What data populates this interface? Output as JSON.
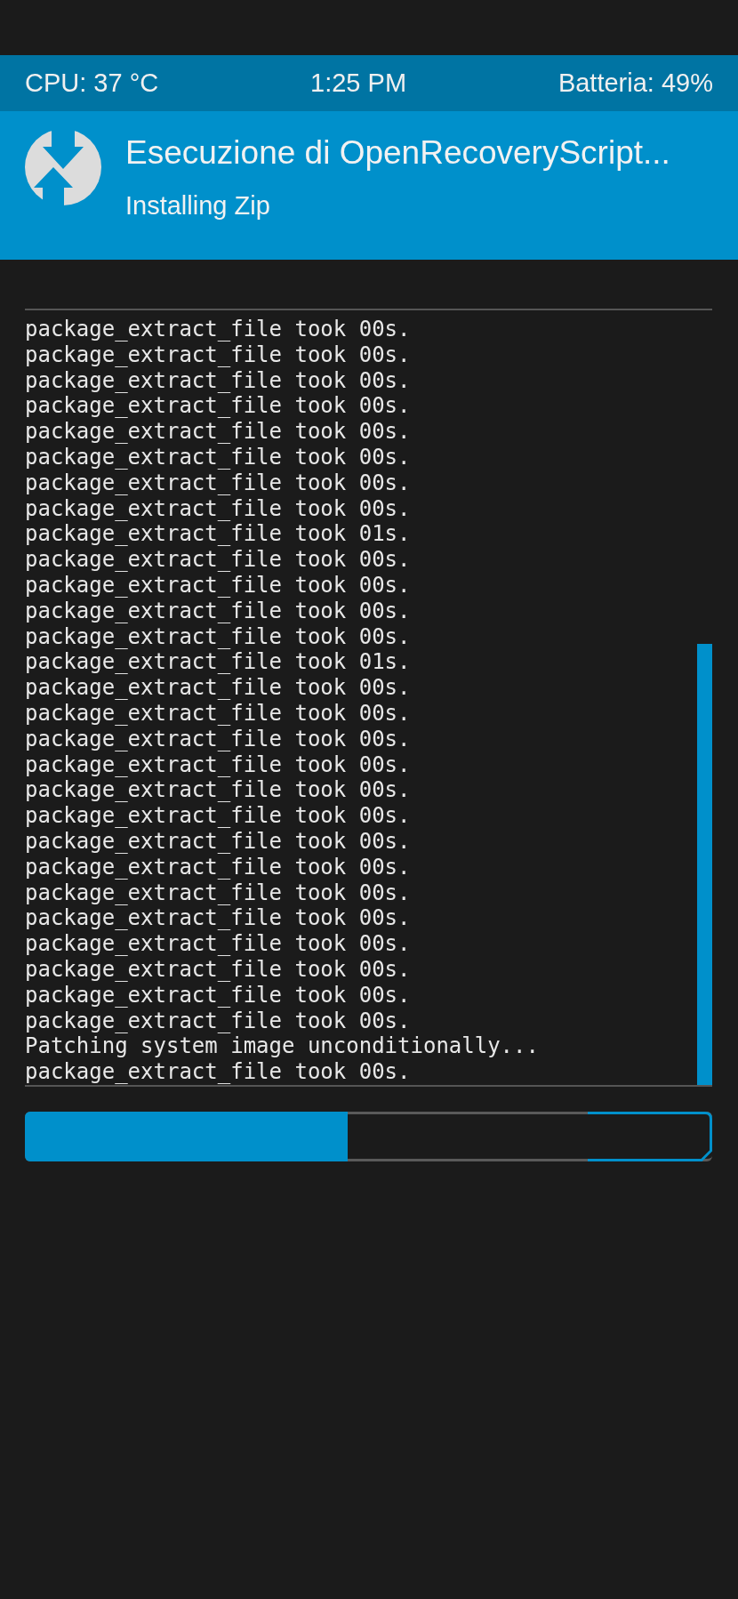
{
  "status_bar": {
    "cpu": "CPU: 37 °C",
    "time": "1:25 PM",
    "battery": "Batteria: 49%"
  },
  "header": {
    "title": "Esecuzione di OpenRecoveryScript...",
    "subtitle": "Installing Zip"
  },
  "console": {
    "lines": [
      "package_extract_file took 00s.",
      "package_extract_file took 00s.",
      "package_extract_file took 00s.",
      "package_extract_file took 00s.",
      "package_extract_file took 00s.",
      "package_extract_file took 00s.",
      "package_extract_file took 00s.",
      "package_extract_file took 00s.",
      "package_extract_file took 01s.",
      "package_extract_file took 00s.",
      "package_extract_file took 00s.",
      "package_extract_file took 00s.",
      "package_extract_file took 00s.",
      "package_extract_file took 01s.",
      "package_extract_file took 00s.",
      "package_extract_file took 00s.",
      "package_extract_file took 00s.",
      "package_extract_file took 00s.",
      "package_extract_file took 00s.",
      "package_extract_file took 00s.",
      "package_extract_file took 00s.",
      "package_extract_file took 00s.",
      "package_extract_file took 00s.",
      "package_extract_file took 00s.",
      "package_extract_file took 00s.",
      "package_extract_file took 00s.",
      "package_extract_file took 00s.",
      "package_extract_file took 00s.",
      "Patching system image unconditionally...",
      "package_extract_file took 00s."
    ]
  },
  "progress": {
    "level": 0.47
  }
}
